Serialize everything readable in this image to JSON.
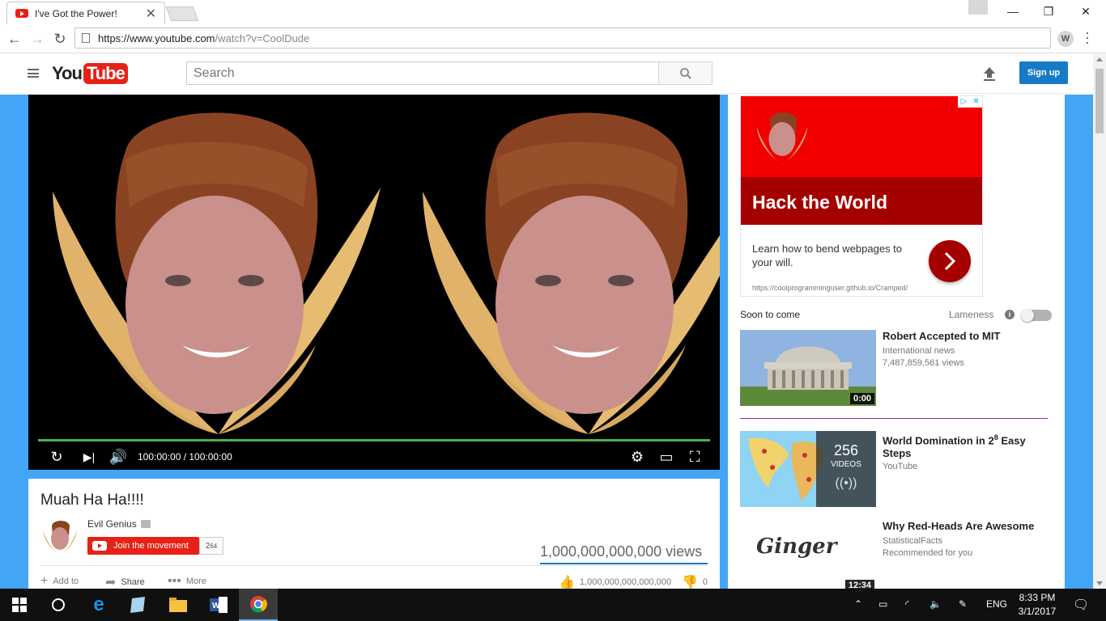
{
  "browser": {
    "tab_title": "I've Got the Power!",
    "url_host": "https://www.youtube.com",
    "url_path": "/watch?v=CoolDude",
    "ext_label": "W"
  },
  "header": {
    "logo_you": "You",
    "logo_tube": "Tube",
    "search_placeholder": "Search",
    "signup_label": "Sign up"
  },
  "player": {
    "timecode": "100:00:00 / 100:00:00",
    "progress": 1.0
  },
  "video": {
    "title": "Muah Ha Ha!!!!",
    "channel": "Evil Genius",
    "subscribe_label": "Join the movement",
    "subscriber_base": "2",
    "subscriber_exp": "64",
    "views": "1,000,000,000,000 views",
    "add_to": "Add to",
    "share": "Share",
    "more": "More",
    "likes": "1,000,000,000,000,000",
    "dislikes": "0"
  },
  "ad": {
    "headline": "Hack the World",
    "body": "Learn how to bend webpages to your will.",
    "url": "https://coolprogramminguser.github.io/Cramped/"
  },
  "sidebar": {
    "soon": "Soon to come",
    "lameness": "Lameness",
    "items": [
      {
        "title": "Robert Accepted to MIT",
        "line1": "International news",
        "line2": "7,487,859,561 views",
        "duration": "0:00"
      },
      {
        "title_prefix": "World Domination in 2",
        "title_sup": "8",
        "title_suffix": " Easy Steps",
        "line1": "YouTube",
        "playlist_count": "256",
        "playlist_label": "VIDEOS"
      },
      {
        "title": "Why Red-Heads Are Awesome",
        "line1": "StatisticalFacts",
        "line2": "Recommended for you",
        "duration": "12:34",
        "thumb_text": "Ginger"
      }
    ]
  },
  "taskbar": {
    "lang": "ENG",
    "time": "8:33 PM",
    "date": "3/1/2017"
  }
}
